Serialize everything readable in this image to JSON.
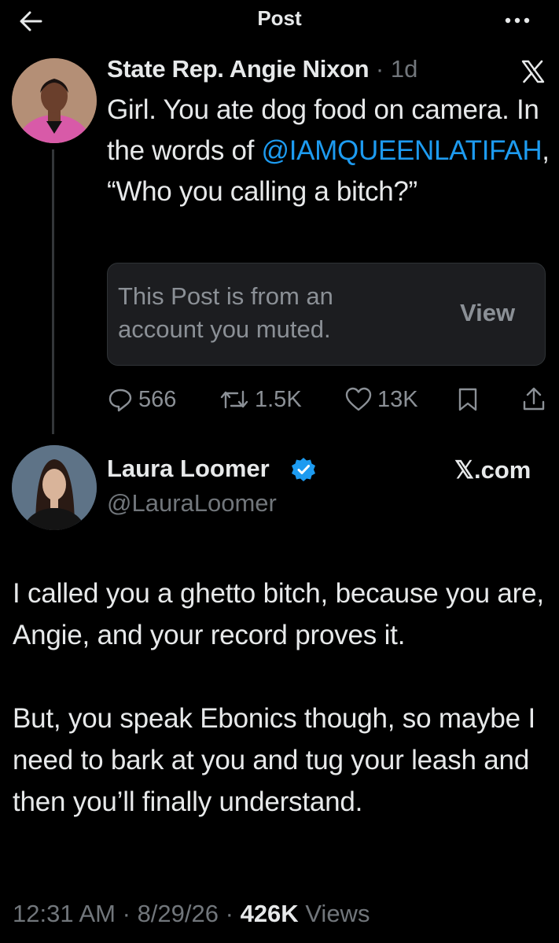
{
  "header": {
    "title": "Post"
  },
  "parent_post": {
    "author_name": "State Rep. Angie Nixon",
    "separator": "·",
    "age": "1d",
    "text_before": "Girl. You ate dog food on camera. In the words of ",
    "mention": "@IAMQUEENLATIFAH",
    "text_after": ", “Who you calling a bitch?”",
    "muted_notice": "This Post is from an account you muted.",
    "view_label": "View",
    "replies": "566",
    "reposts": "1.5K",
    "likes": "13K"
  },
  "main_post": {
    "author_name": "Laura Loomer",
    "handle": "@LauraLoomer",
    "source_label": "𝕏.com",
    "paragraphs": [
      "I called you a ghetto bitch, because you are, Angie, and your record proves it.",
      "But, you speak Ebonics though, so maybe I need to bark at you and tug your leash and then you’ll finally understand."
    ],
    "time": "12:31 AM",
    "date": "8/29/26",
    "dot": "·",
    "views_count": "426K",
    "views_label": "Views"
  },
  "icons": {
    "back": "arrow-left-icon",
    "more": "more-horizontal-icon",
    "platform": "x-logo-icon",
    "verified": "verified-badge-icon",
    "reply": "reply-icon",
    "repost": "repost-icon",
    "like": "heart-icon",
    "bookmark": "bookmark-icon",
    "share": "share-icon"
  },
  "colors": {
    "background": "#000000",
    "text": "#e7e9ea",
    "secondary_text": "#71767b",
    "link": "#1d9bf0",
    "verified": "#1d9bf0",
    "card": "#1c1d20"
  }
}
